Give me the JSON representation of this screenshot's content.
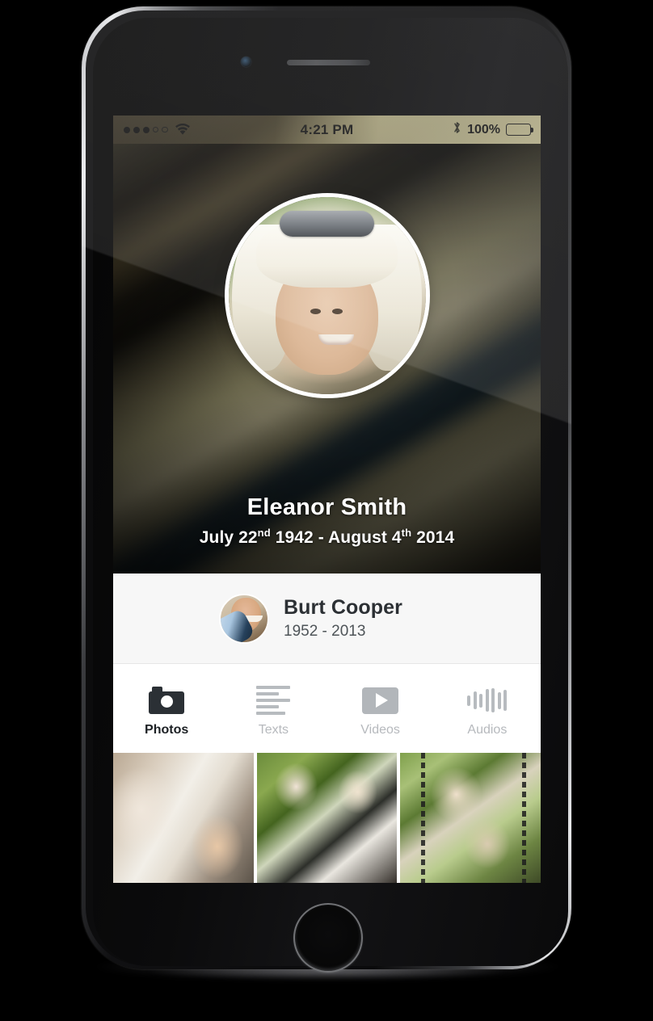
{
  "device": {
    "name": "iphone-6-space-gray",
    "home_button": "home-button",
    "camera": "front-camera",
    "speaker": "earpiece-speaker"
  },
  "status_bar": {
    "signal_dots_filled": 3,
    "signal_dots_empty": 2,
    "wifi": "wifi-icon",
    "time": "4:21 PM",
    "bluetooth": "bluetooth-icon",
    "battery_percent": "100%",
    "battery_level": 100
  },
  "hero": {
    "avatar": "profile-photo",
    "name": "Eleanor Smith",
    "dates": {
      "birth_month_day": "July 22",
      "birth_ordinal": "nd",
      "birth_year": "1942",
      "separator": " - ",
      "death_month_day": "August 4",
      "death_ordinal": "th",
      "death_year": "2014"
    },
    "dates_plain": "July 22nd 1942 - August 4th 2014"
  },
  "contact_card": {
    "avatar": "contact-photo",
    "name": "Burt Cooper",
    "years": "1952 - 2013"
  },
  "tabs": [
    {
      "id": "photos",
      "label": "Photos",
      "icon": "camera-icon",
      "active": true
    },
    {
      "id": "texts",
      "label": "Texts",
      "icon": "text-lines-icon",
      "active": false
    },
    {
      "id": "videos",
      "label": "Videos",
      "icon": "play-video-icon",
      "active": false
    },
    {
      "id": "audios",
      "label": "Audios",
      "icon": "waveform-icon",
      "active": false
    }
  ],
  "photo_grid": [
    {
      "id": "photo-1",
      "alt": "woman-and-girl-at-table"
    },
    {
      "id": "photo-2",
      "alt": "two-women-walking-outdoors"
    },
    {
      "id": "photo-3",
      "alt": "woman-and-girl-on-swing"
    }
  ],
  "colors": {
    "accent_dark": "#2b3035",
    "inactive_gray": "#b7bbbf",
    "card_bg": "#f7f7f7",
    "tab_bg": "#ffffff",
    "status_khaki": "#cec79b",
    "text_dark": "#2c3034"
  }
}
